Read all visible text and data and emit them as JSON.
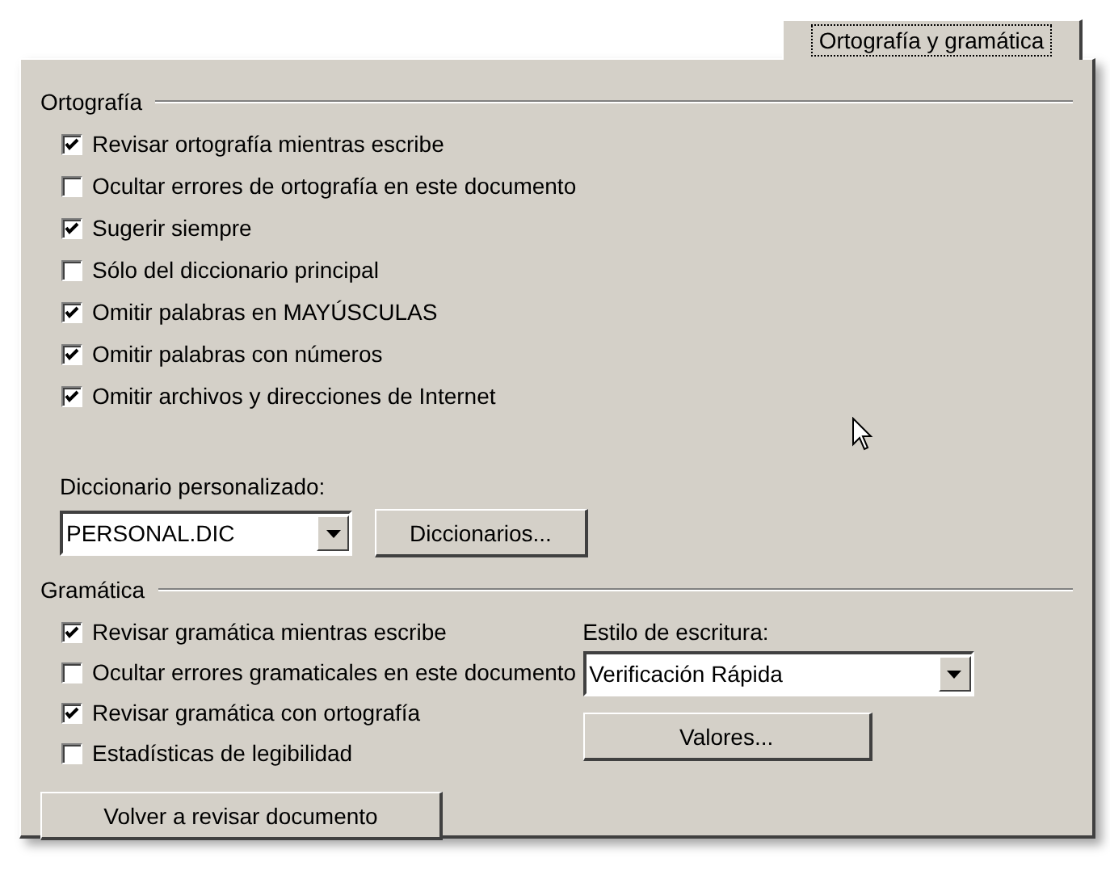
{
  "tab": {
    "label": "Ortografía y gramática",
    "selected": true
  },
  "spelling": {
    "title": "Ortografía",
    "options": [
      {
        "label": "Revisar ortografía mientras escribe",
        "checked": true
      },
      {
        "label": "Ocultar errores de ortografía en este documento",
        "checked": false
      },
      {
        "label": "Sugerir siempre",
        "checked": true
      },
      {
        "label": "Sólo del diccionario principal",
        "checked": false
      },
      {
        "label": "Omitir palabras en MAYÚSCULAS",
        "checked": true
      },
      {
        "label": "Omitir palabras con números",
        "checked": true
      },
      {
        "label": "Omitir archivos y direcciones de Internet",
        "checked": true
      }
    ],
    "custom_dictionary": {
      "label": "Diccionario personalizado:",
      "value": "PERSONAL.DIC"
    },
    "dictionaries_button": "Diccionarios..."
  },
  "grammar": {
    "title": "Gramática",
    "options": [
      {
        "label": "Revisar gramática mientras escribe",
        "checked": true
      },
      {
        "label": "Ocultar errores gramaticales en este documento",
        "checked": false
      },
      {
        "label": "Revisar gramática con ortografía",
        "checked": true
      },
      {
        "label": "Estadísticas de legibilidad",
        "checked": false
      }
    ],
    "writing_style": {
      "label": "Estilo de escritura:",
      "value": "Verificación Rápida"
    },
    "settings_button": "Valores...",
    "recheck_button": "Volver a revisar documento"
  }
}
